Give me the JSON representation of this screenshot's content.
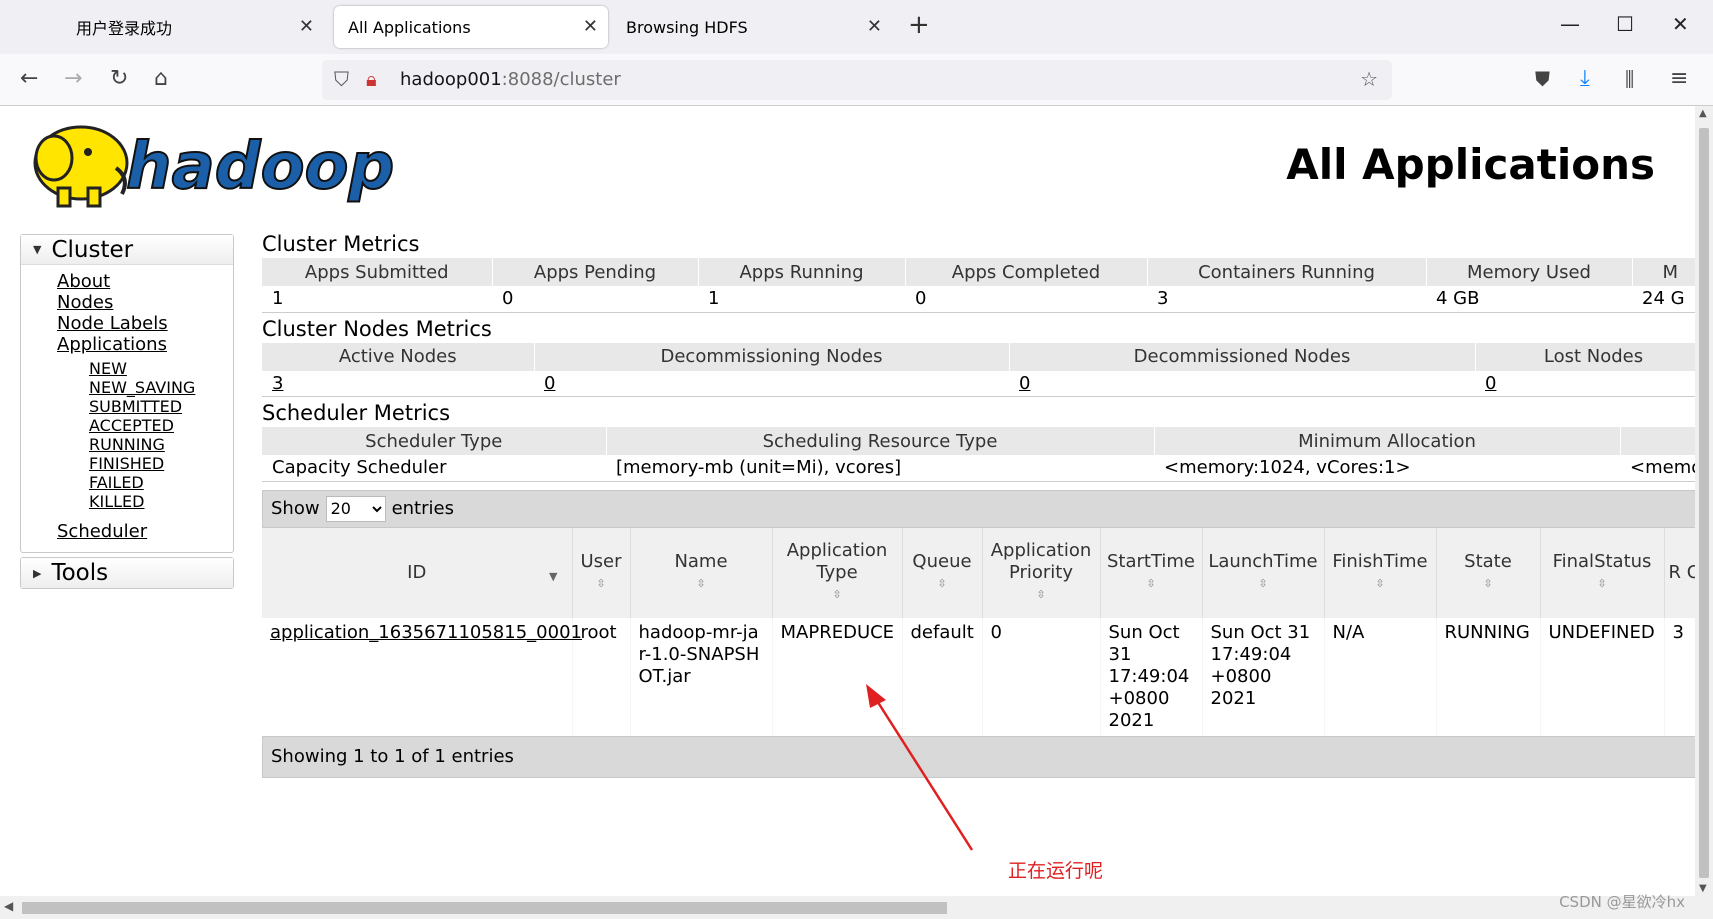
{
  "browser": {
    "tabs": [
      {
        "label": "用户登录成功",
        "active": false
      },
      {
        "label": "All Applications",
        "active": true
      },
      {
        "label": "Browsing HDFS",
        "active": false
      }
    ],
    "url_host": "hadoop001",
    "url_path": ":8088/cluster"
  },
  "page": {
    "logo_text": "hadoop",
    "title": "All Applications"
  },
  "sidebar": {
    "cluster_label": "Cluster",
    "links": [
      "About",
      "Nodes",
      "Node Labels",
      "Applications"
    ],
    "app_states": [
      "NEW",
      "NEW_SAVING",
      "SUBMITTED",
      "ACCEPTED",
      "RUNNING",
      "FINISHED",
      "FAILED",
      "KILLED"
    ],
    "scheduler_link": "Scheduler",
    "tools_label": "Tools"
  },
  "cluster_metrics": {
    "title": "Cluster Metrics",
    "headers": [
      "Apps Submitted",
      "Apps Pending",
      "Apps Running",
      "Apps Completed",
      "Containers Running",
      "Memory Used",
      "M"
    ],
    "values": [
      "1",
      "0",
      "1",
      "0",
      "3",
      "4 GB",
      "24 G"
    ]
  },
  "node_metrics": {
    "title": "Cluster Nodes Metrics",
    "headers": [
      "Active Nodes",
      "Decommissioning Nodes",
      "Decommissioned Nodes",
      "Lost Nodes"
    ],
    "values": [
      "3",
      "0",
      "0",
      "0"
    ]
  },
  "scheduler_metrics": {
    "title": "Scheduler Metrics",
    "headers": [
      "Scheduler Type",
      "Scheduling Resource Type",
      "Minimum Allocation",
      ""
    ],
    "values": [
      "Capacity Scheduler",
      "[memory-mb (unit=Mi), vcores]",
      "<memory:1024, vCores:1>",
      "<memo"
    ]
  },
  "apps_table": {
    "show_label": "Show",
    "entries_value": "20",
    "entries_label": "entries",
    "headers": [
      "ID",
      "User",
      "Name",
      "Application Type",
      "Queue",
      "Application Priority",
      "StartTime",
      "LaunchTime",
      "FinishTime",
      "State",
      "FinalStatus",
      "R Co"
    ],
    "rows": [
      {
        "id": "application_1635671105815_0001",
        "user": "root",
        "name": "hadoop-mr-jar-1.0-SNAPSHOT.jar",
        "type": "MAPREDUCE",
        "queue": "default",
        "priority": "0",
        "start": "Sun Oct 31 17:49:04 +0800 2021",
        "launch": "Sun Oct 31 17:49:04 +0800 2021",
        "finish": "N/A",
        "state": "RUNNING",
        "final_status": "UNDEFINED",
        "r": "3"
      }
    ],
    "footer": "Showing 1 to 1 of 1 entries"
  },
  "annotation": "正在运行呢",
  "watermark": "CSDN @星欲冷hx",
  "colors": {
    "annotation": "#e02020",
    "logo_yellow": "#ffe500",
    "logo_blue": "#1a5fa8"
  }
}
